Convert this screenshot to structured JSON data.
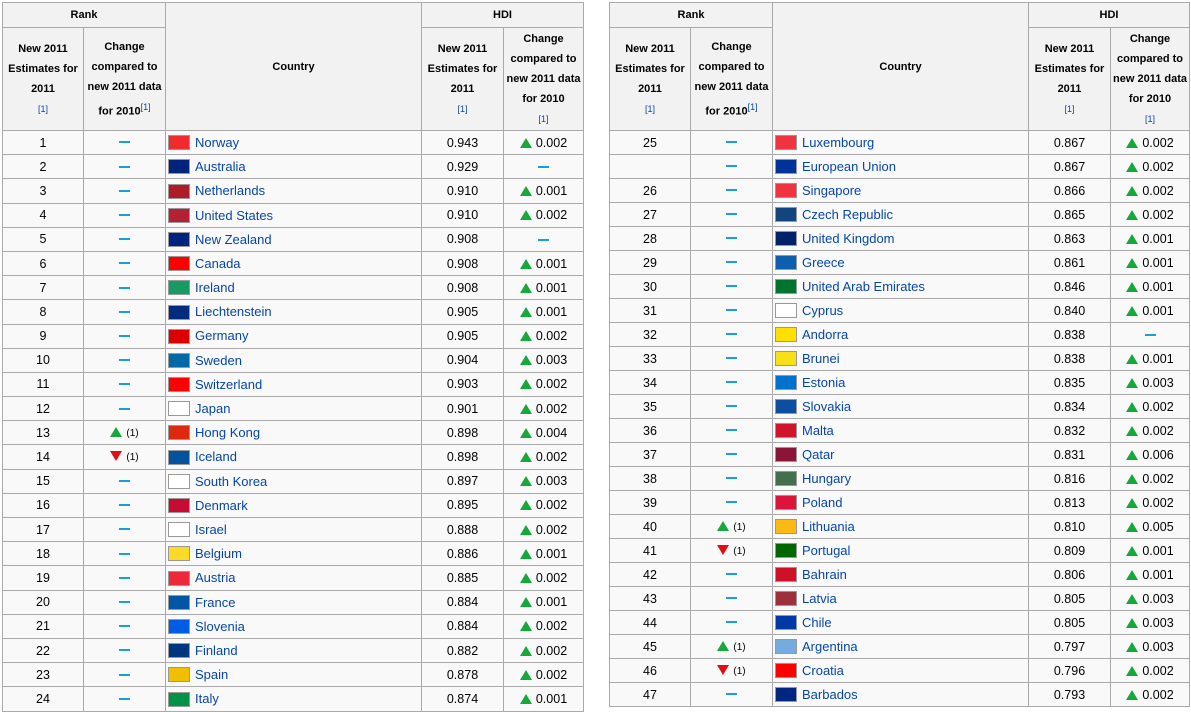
{
  "header": {
    "rank": "Rank",
    "country": "Country",
    "hdi": "HDI",
    "new_estimates": "New 2011 Estimates for 2011",
    "change_rank": "Change compared to new 2011 data for 2010",
    "change_hdi": "Change compared to new 2011 data for 2010",
    "footnote": "[1]"
  },
  "colors": {
    "up": "#16a83a",
    "down": "#e20e14",
    "same": "#1a9ed9",
    "link": "#0645ad"
  },
  "left_rows": [
    {
      "rank": "1",
      "change": "same",
      "change_val": "",
      "country": "Norway",
      "flag": "#ef2b2d",
      "hdi": "0.943",
      "delta": "up",
      "delta_val": "0.002"
    },
    {
      "rank": "2",
      "change": "same",
      "change_val": "",
      "country": "Australia",
      "flag": "#00247d",
      "hdi": "0.929",
      "delta": "same",
      "delta_val": ""
    },
    {
      "rank": "3",
      "change": "same",
      "change_val": "",
      "country": "Netherlands",
      "flag": "#ae1c28",
      "hdi": "0.910",
      "delta": "up",
      "delta_val": "0.001"
    },
    {
      "rank": "4",
      "change": "same",
      "change_val": "",
      "country": "United States",
      "flag": "#b22234",
      "hdi": "0.910",
      "delta": "up",
      "delta_val": "0.002"
    },
    {
      "rank": "5",
      "change": "same",
      "change_val": "",
      "country": "New Zealand",
      "flag": "#00247d",
      "hdi": "0.908",
      "delta": "same",
      "delta_val": ""
    },
    {
      "rank": "6",
      "change": "same",
      "change_val": "",
      "country": "Canada",
      "flag": "#ff0000",
      "hdi": "0.908",
      "delta": "up",
      "delta_val": "0.001"
    },
    {
      "rank": "7",
      "change": "same",
      "change_val": "",
      "country": "Ireland",
      "flag": "#169b62",
      "hdi": "0.908",
      "delta": "up",
      "delta_val": "0.001"
    },
    {
      "rank": "8",
      "change": "same",
      "change_val": "",
      "country": "Liechtenstein",
      "flag": "#002b7f",
      "hdi": "0.905",
      "delta": "up",
      "delta_val": "0.001"
    },
    {
      "rank": "9",
      "change": "same",
      "change_val": "",
      "country": "Germany",
      "flag": "#dd0000",
      "hdi": "0.905",
      "delta": "up",
      "delta_val": "0.002"
    },
    {
      "rank": "10",
      "change": "same",
      "change_val": "",
      "country": "Sweden",
      "flag": "#006aa7",
      "hdi": "0.904",
      "delta": "up",
      "delta_val": "0.003"
    },
    {
      "rank": "11",
      "change": "same",
      "change_val": "",
      "country": "Switzerland",
      "flag": "#ff0000",
      "hdi": "0.903",
      "delta": "up",
      "delta_val": "0.002"
    },
    {
      "rank": "12",
      "change": "same",
      "change_val": "",
      "country": "Japan",
      "flag": "#ffffff",
      "hdi": "0.901",
      "delta": "up",
      "delta_val": "0.002"
    },
    {
      "rank": "13",
      "change": "up",
      "change_val": "(1)",
      "country": "Hong Kong",
      "flag": "#de2910",
      "hdi": "0.898",
      "delta": "up",
      "delta_val": "0.004"
    },
    {
      "rank": "14",
      "change": "down",
      "change_val": "(1)",
      "country": "Iceland",
      "flag": "#02529c",
      "hdi": "0.898",
      "delta": "up",
      "delta_val": "0.002"
    },
    {
      "rank": "15",
      "change": "same",
      "change_val": "",
      "country": "South Korea",
      "flag": "#ffffff",
      "hdi": "0.897",
      "delta": "up",
      "delta_val": "0.003"
    },
    {
      "rank": "16",
      "change": "same",
      "change_val": "",
      "country": "Denmark",
      "flag": "#c60c30",
      "hdi": "0.895",
      "delta": "up",
      "delta_val": "0.002"
    },
    {
      "rank": "17",
      "change": "same",
      "change_val": "",
      "country": "Israel",
      "flag": "#ffffff",
      "hdi": "0.888",
      "delta": "up",
      "delta_val": "0.002"
    },
    {
      "rank": "18",
      "change": "same",
      "change_val": "",
      "country": "Belgium",
      "flag": "#fdda24",
      "hdi": "0.886",
      "delta": "up",
      "delta_val": "0.001"
    },
    {
      "rank": "19",
      "change": "same",
      "change_val": "",
      "country": "Austria",
      "flag": "#ed2939",
      "hdi": "0.885",
      "delta": "up",
      "delta_val": "0.002"
    },
    {
      "rank": "20",
      "change": "same",
      "change_val": "",
      "country": "France",
      "flag": "#0055a4",
      "hdi": "0.884",
      "delta": "up",
      "delta_val": "0.001"
    },
    {
      "rank": "21",
      "change": "same",
      "change_val": "",
      "country": "Slovenia",
      "flag": "#005ce5",
      "hdi": "0.884",
      "delta": "up",
      "delta_val": "0.002"
    },
    {
      "rank": "22",
      "change": "same",
      "change_val": "",
      "country": "Finland",
      "flag": "#003580",
      "hdi": "0.882",
      "delta": "up",
      "delta_val": "0.002"
    },
    {
      "rank": "23",
      "change": "same",
      "change_val": "",
      "country": "Spain",
      "flag": "#f1bf00",
      "hdi": "0.878",
      "delta": "up",
      "delta_val": "0.002"
    },
    {
      "rank": "24",
      "change": "same",
      "change_val": "",
      "country": "Italy",
      "flag": "#009246",
      "hdi": "0.874",
      "delta": "up",
      "delta_val": "0.001"
    }
  ],
  "right_rows": [
    {
      "rank": "25",
      "change": "same",
      "change_val": "",
      "country": "Luxembourg",
      "flag": "#ef3340",
      "hdi": "0.867",
      "delta": "up",
      "delta_val": "0.002"
    },
    {
      "rank": "",
      "change": "same",
      "change_val": "",
      "country": "European Union",
      "flag": "#003399",
      "hdi": "0.867",
      "delta": "up",
      "delta_val": "0.002"
    },
    {
      "rank": "26",
      "change": "same",
      "change_val": "",
      "country": "Singapore",
      "flag": "#ef3340",
      "hdi": "0.866",
      "delta": "up",
      "delta_val": "0.002"
    },
    {
      "rank": "27",
      "change": "same",
      "change_val": "",
      "country": "Czech Republic",
      "flag": "#11457e",
      "hdi": "0.865",
      "delta": "up",
      "delta_val": "0.002"
    },
    {
      "rank": "28",
      "change": "same",
      "change_val": "",
      "country": "United Kingdom",
      "flag": "#012169",
      "hdi": "0.863",
      "delta": "up",
      "delta_val": "0.001"
    },
    {
      "rank": "29",
      "change": "same",
      "change_val": "",
      "country": "Greece",
      "flag": "#0d5eaf",
      "hdi": "0.861",
      "delta": "up",
      "delta_val": "0.001"
    },
    {
      "rank": "30",
      "change": "same",
      "change_val": "",
      "country": "United Arab Emirates",
      "flag": "#00732f",
      "hdi": "0.846",
      "delta": "up",
      "delta_val": "0.001"
    },
    {
      "rank": "31",
      "change": "same",
      "change_val": "",
      "country": "Cyprus",
      "flag": "#ffffff",
      "hdi": "0.840",
      "delta": "up",
      "delta_val": "0.001"
    },
    {
      "rank": "32",
      "change": "same",
      "change_val": "",
      "country": "Andorra",
      "flag": "#fedf00",
      "hdi": "0.838",
      "delta": "same",
      "delta_val": ""
    },
    {
      "rank": "33",
      "change": "same",
      "change_val": "",
      "country": "Brunei",
      "flag": "#f7e017",
      "hdi": "0.838",
      "delta": "up",
      "delta_val": "0.001"
    },
    {
      "rank": "34",
      "change": "same",
      "change_val": "",
      "country": "Estonia",
      "flag": "#0072ce",
      "hdi": "0.835",
      "delta": "up",
      "delta_val": "0.003"
    },
    {
      "rank": "35",
      "change": "same",
      "change_val": "",
      "country": "Slovakia",
      "flag": "#0b4ea2",
      "hdi": "0.834",
      "delta": "up",
      "delta_val": "0.002"
    },
    {
      "rank": "36",
      "change": "same",
      "change_val": "",
      "country": "Malta",
      "flag": "#cf142b",
      "hdi": "0.832",
      "delta": "up",
      "delta_val": "0.002"
    },
    {
      "rank": "37",
      "change": "same",
      "change_val": "",
      "country": "Qatar",
      "flag": "#8a1538",
      "hdi": "0.831",
      "delta": "up",
      "delta_val": "0.006"
    },
    {
      "rank": "38",
      "change": "same",
      "change_val": "",
      "country": "Hungary",
      "flag": "#436f4d",
      "hdi": "0.816",
      "delta": "up",
      "delta_val": "0.002"
    },
    {
      "rank": "39",
      "change": "same",
      "change_val": "",
      "country": "Poland",
      "flag": "#dc143c",
      "hdi": "0.813",
      "delta": "up",
      "delta_val": "0.002"
    },
    {
      "rank": "40",
      "change": "up",
      "change_val": "(1)",
      "country": "Lithuania",
      "flag": "#fdb913",
      "hdi": "0.810",
      "delta": "up",
      "delta_val": "0.005"
    },
    {
      "rank": "41",
      "change": "down",
      "change_val": "(1)",
      "country": "Portugal",
      "flag": "#006600",
      "hdi": "0.809",
      "delta": "up",
      "delta_val": "0.001"
    },
    {
      "rank": "42",
      "change": "same",
      "change_val": "",
      "country": "Bahrain",
      "flag": "#ce1126",
      "hdi": "0.806",
      "delta": "up",
      "delta_val": "0.001"
    },
    {
      "rank": "43",
      "change": "same",
      "change_val": "",
      "country": "Latvia",
      "flag": "#9e3039",
      "hdi": "0.805",
      "delta": "up",
      "delta_val": "0.003"
    },
    {
      "rank": "44",
      "change": "same",
      "change_val": "",
      "country": "Chile",
      "flag": "#0039a6",
      "hdi": "0.805",
      "delta": "up",
      "delta_val": "0.003"
    },
    {
      "rank": "45",
      "change": "up",
      "change_val": "(1)",
      "country": "Argentina",
      "flag": "#74acdf",
      "hdi": "0.797",
      "delta": "up",
      "delta_val": "0.003"
    },
    {
      "rank": "46",
      "change": "down",
      "change_val": "(1)",
      "country": "Croatia",
      "flag": "#ff0000",
      "hdi": "0.796",
      "delta": "up",
      "delta_val": "0.002"
    },
    {
      "rank": "47",
      "change": "same",
      "change_val": "",
      "country": "Barbados",
      "flag": "#00267f",
      "hdi": "0.793",
      "delta": "up",
      "delta_val": "0.002"
    }
  ]
}
